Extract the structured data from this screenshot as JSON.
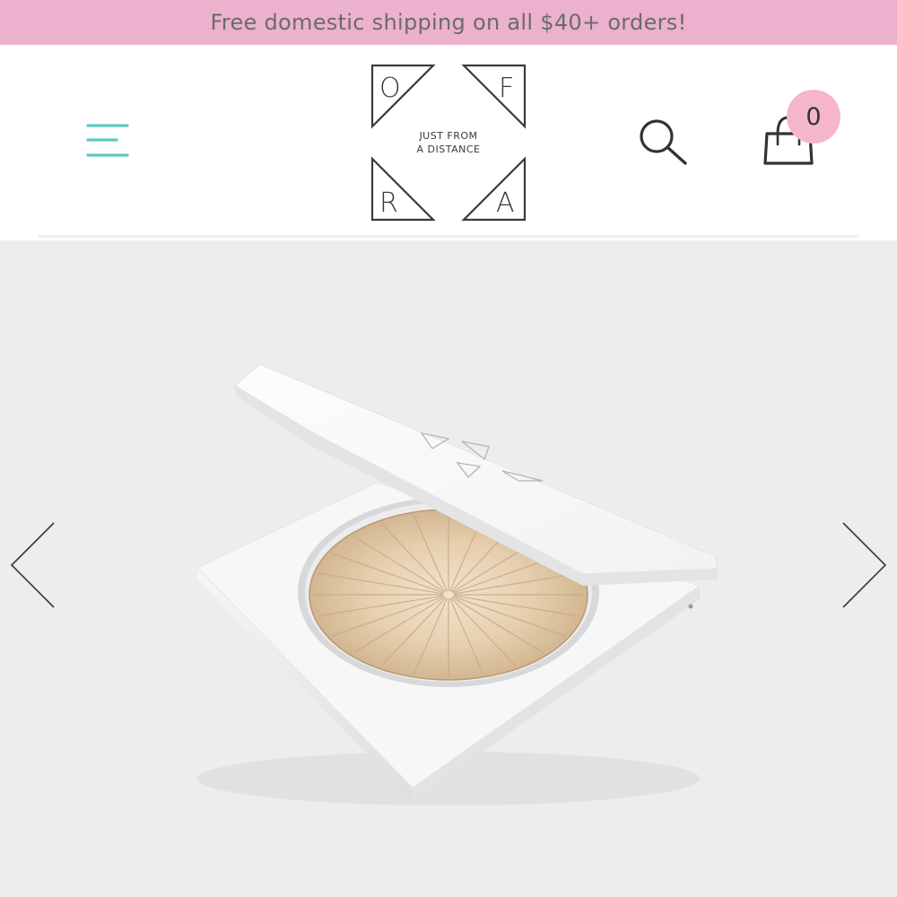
{
  "promo_banner": {
    "text": "Free domestic shipping on all $40+ orders!",
    "background": "#ebb1cd",
    "text_color": "#6b6b6b"
  },
  "header": {
    "menu_icon": "hamburger-menu-icon",
    "menu_color": "#5cc8bf",
    "logo": {
      "letters": [
        "O",
        "F",
        "R",
        "A"
      ],
      "tagline_line1": "JUST FROM",
      "tagline_line2": "A DISTANCE"
    },
    "search_icon": "search-icon",
    "cart_icon": "shopping-bag-icon",
    "cart_count": "0",
    "badge_color": "#f5b6c9"
  },
  "gallery": {
    "background": "#ededee",
    "prev_icon": "chevron-left-icon",
    "next_icon": "chevron-right-icon",
    "product_image": "highlighter-compact-product-photo"
  }
}
